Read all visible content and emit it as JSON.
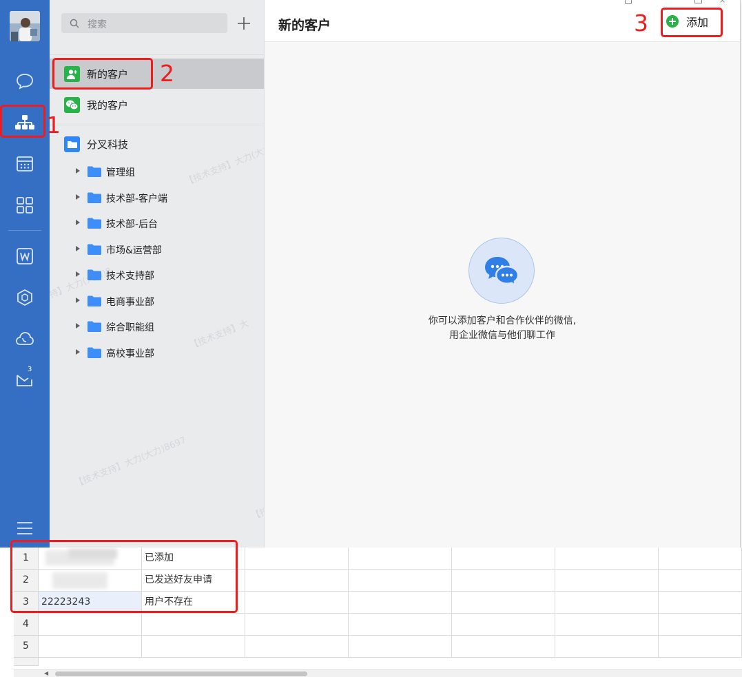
{
  "search": {
    "placeholder": "搜索"
  },
  "nav": {
    "new_customer": "新的客户",
    "my_customer": "我的客户"
  },
  "org": {
    "root": "分叉科技",
    "departments": [
      "管理组",
      "技术部-客户端",
      "技术部-后台",
      "市场&运营部",
      "技术支持部",
      "电商事业部",
      "综合职能组",
      "高校事业部"
    ]
  },
  "detail": {
    "title": "新的客户",
    "add_label": "添加",
    "empty_line1": "你可以添加客户和合作伙伴的微信,",
    "empty_line2": "用企业微信与他们聊工作"
  },
  "sidebar": {
    "mail_badge": "3"
  },
  "watermark": {
    "a": "【技术支持】大力(大力)8697",
    "b": "持】大力(大力)8",
    "c": "【技术支持】大",
    "d": "【技术支持】大力(大力)8697",
    "e": "【技"
  },
  "annotations": [
    "1",
    "2",
    "3"
  ],
  "sheet": {
    "rows": [
      {
        "num": "1",
        "a": "",
        "b": "已添加"
      },
      {
        "num": "2",
        "a": "",
        "b": "已发送好友申请"
      },
      {
        "num": "3",
        "a": "22223243",
        "b": "用户不存在"
      },
      {
        "num": "4",
        "a": "",
        "b": ""
      },
      {
        "num": "5",
        "a": "",
        "b": ""
      }
    ]
  },
  "colors": {
    "sidebar": "#356fc4",
    "accent_green": "#27b348",
    "annotation_red": "#ee1c1c",
    "folder_blue": "#3d8ef8"
  }
}
